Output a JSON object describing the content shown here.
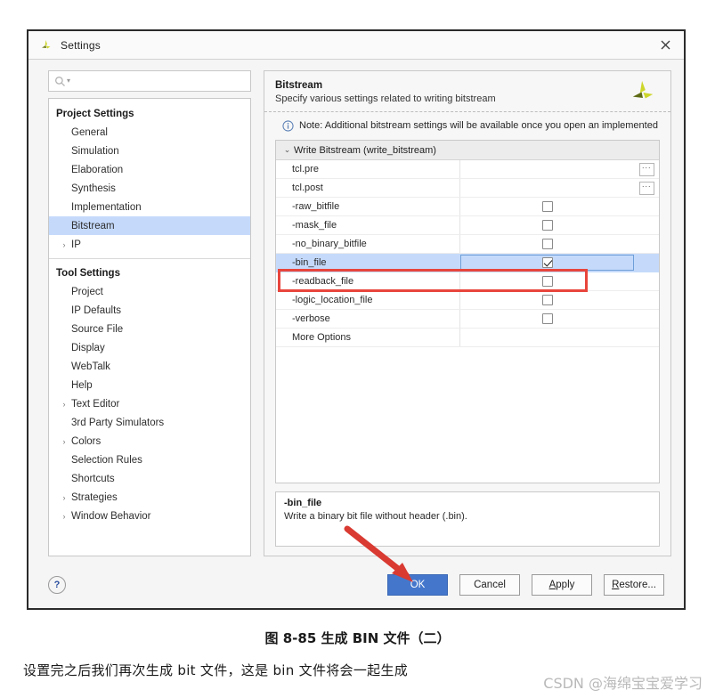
{
  "dialog": {
    "title": "Settings",
    "close_label": "✕",
    "logo_icon": "vivado-logo-icon"
  },
  "search": {
    "placeholder": "",
    "value": "",
    "icon": "search-icon"
  },
  "sidebar": {
    "groups": [
      {
        "label": "Project Settings",
        "items": [
          {
            "label": "General",
            "expandable": false,
            "selected": false
          },
          {
            "label": "Simulation",
            "expandable": false,
            "selected": false
          },
          {
            "label": "Elaboration",
            "expandable": false,
            "selected": false
          },
          {
            "label": "Synthesis",
            "expandable": false,
            "selected": false
          },
          {
            "label": "Implementation",
            "expandable": false,
            "selected": false
          },
          {
            "label": "Bitstream",
            "expandable": false,
            "selected": true
          },
          {
            "label": "IP",
            "expandable": true,
            "selected": false
          }
        ]
      },
      {
        "label": "Tool Settings",
        "items": [
          {
            "label": "Project",
            "expandable": false,
            "selected": false
          },
          {
            "label": "IP Defaults",
            "expandable": false,
            "selected": false
          },
          {
            "label": "Source File",
            "expandable": false,
            "selected": false
          },
          {
            "label": "Display",
            "expandable": false,
            "selected": false
          },
          {
            "label": "WebTalk",
            "expandable": false,
            "selected": false
          },
          {
            "label": "Help",
            "expandable": false,
            "selected": false
          },
          {
            "label": "Text Editor",
            "expandable": true,
            "selected": false
          },
          {
            "label": "3rd Party Simulators",
            "expandable": false,
            "selected": false
          },
          {
            "label": "Colors",
            "expandable": true,
            "selected": false
          },
          {
            "label": "Selection Rules",
            "expandable": false,
            "selected": false
          },
          {
            "label": "Shortcuts",
            "expandable": false,
            "selected": false
          },
          {
            "label": "Strategies",
            "expandable": true,
            "selected": false
          },
          {
            "label": "Window Behavior",
            "expandable": true,
            "selected": false
          }
        ]
      }
    ]
  },
  "panel": {
    "title": "Bitstream",
    "subtitle": "Specify various settings related to writing bitstream",
    "note": "Note: Additional bitstream settings will be available once you open an implemented d",
    "note_icon": "info-icon",
    "table_header": "Write Bitstream (write_bitstream)",
    "rows": [
      {
        "name": "tcl.pre",
        "control": "browse",
        "checked": false,
        "selected": false
      },
      {
        "name": "tcl.post",
        "control": "browse",
        "checked": false,
        "selected": false
      },
      {
        "name": "-raw_bitfile",
        "control": "checkbox",
        "checked": false,
        "selected": false
      },
      {
        "name": "-mask_file",
        "control": "checkbox",
        "checked": false,
        "selected": false
      },
      {
        "name": "-no_binary_bitfile",
        "control": "checkbox",
        "checked": false,
        "selected": false
      },
      {
        "name": "-bin_file",
        "control": "checkbox",
        "checked": true,
        "selected": true
      },
      {
        "name": "-readback_file",
        "control": "checkbox",
        "checked": false,
        "selected": false
      },
      {
        "name": "-logic_location_file",
        "control": "checkbox",
        "checked": false,
        "selected": false
      },
      {
        "name": "-verbose",
        "control": "checkbox",
        "checked": false,
        "selected": false
      },
      {
        "name": "More Options",
        "control": "none",
        "checked": false,
        "selected": false
      }
    ],
    "browse_label": "···"
  },
  "description": {
    "title": "-bin_file",
    "text": "Write a binary bit file without header (.bin)."
  },
  "footer": {
    "help_label": "?",
    "buttons": [
      {
        "label": "OK",
        "primary": true,
        "mnemonic": ""
      },
      {
        "label": "Cancel",
        "primary": false,
        "mnemonic": ""
      },
      {
        "label": "Apply",
        "primary": false,
        "mnemonic": "A"
      },
      {
        "label": "Restore...",
        "primary": false,
        "mnemonic": "R"
      }
    ]
  },
  "annotations": {
    "highlight_color": "#e8453c",
    "arrow_color": "#d93a32"
  },
  "page": {
    "figure_caption": "图 8-85  生成 BIN 文件（二）",
    "body_text": "设置完之后我们再次生成 bit 文件，这是 bin 文件将会一起生成",
    "watermark": "CSDN @海绵宝宝爱学习"
  }
}
